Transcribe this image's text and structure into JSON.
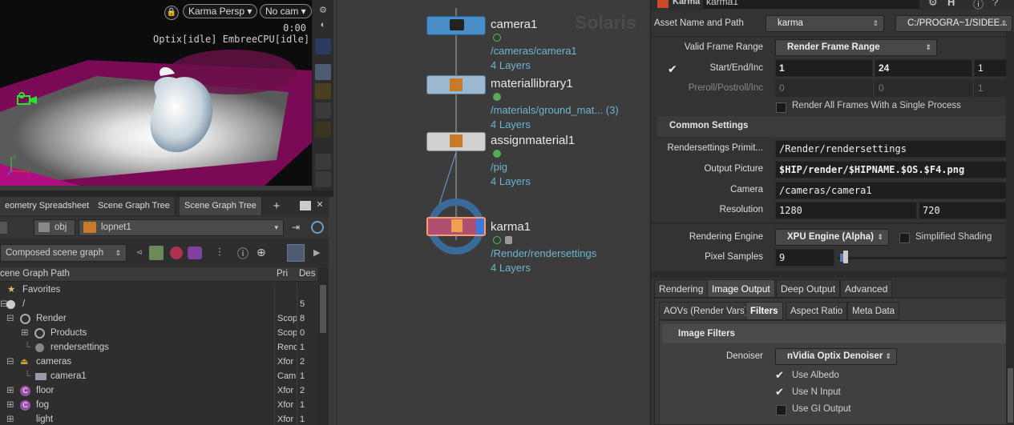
{
  "viewport": {
    "camera_menu": "Karma Persp",
    "view_menu": "No cam",
    "time": "0:00",
    "status": "Optix[idle] EmbreeCPU[idle]"
  },
  "scene_graph": {
    "tabs": [
      "eometry Spreadsheet",
      "Scene Graph Tree",
      "Scene Graph Tree"
    ],
    "path": {
      "obj": "obj",
      "lopnet": "lopnet1"
    },
    "mode": "Composed scene graph",
    "columns": {
      "path": "cene Graph Path",
      "pri": "Pri",
      "des": "Des"
    },
    "rows": [
      {
        "name": "Favorites",
        "pri": "",
        "des": ""
      },
      {
        "name": "/",
        "pri": "",
        "des": "5"
      },
      {
        "name": "Render",
        "pri": "Scop",
        "des": "8"
      },
      {
        "name": "Products",
        "pri": "Scop",
        "des": "0"
      },
      {
        "name": "rendersettings",
        "pri": "Rend",
        "des": "1"
      },
      {
        "name": "cameras",
        "pri": "Xfor",
        "des": "2"
      },
      {
        "name": "camera1",
        "pri": "Cam",
        "des": "1"
      },
      {
        "name": "floor",
        "pri": "Xfor",
        "des": "2"
      },
      {
        "name": "fog",
        "pri": "Xfor",
        "des": "1"
      },
      {
        "name": "light",
        "pri": "Xfor",
        "des": "1"
      }
    ]
  },
  "network": {
    "watermark": "Solaris",
    "nodes": [
      {
        "name": "camera1",
        "path": "/cameras/camera1",
        "layers": "4 Layers"
      },
      {
        "name": "materiallibrary1",
        "path": "/materials/ground_mat... (3)",
        "layers": "4 Layers"
      },
      {
        "name": "assignmaterial1",
        "path": "/pig",
        "layers": "4 Layers"
      },
      {
        "name": "karma1",
        "path": "/Render/rendersettings",
        "layers": "4 Layers"
      }
    ]
  },
  "params": {
    "node_type": "Karma",
    "node_name": "karma1",
    "asset_label": "Asset Name and Path",
    "asset_name": "karma",
    "asset_path": "C:/PROGRA~1/SIDEE...",
    "valid_frame_range_label": "Valid Frame Range",
    "valid_frame_range": "Render Frame Range",
    "start_end_inc_label": "Start/End/Inc",
    "start": "1",
    "end": "24",
    "inc": "1",
    "preroll_label": "Preroll/Postroll/Inc",
    "preroll": "0",
    "postroll": "0",
    "preroll_inc": "1",
    "render_all_frames": "Render All Frames With a Single Process",
    "common_settings": "Common Settings",
    "rendersettings_label": "Rendersettings Primit...",
    "rendersettings": "/Render/rendersettings",
    "output_label": "Output Picture",
    "output": "$HIP/render/$HIPNAME.$OS.$F4.png",
    "camera_label": "Camera",
    "camera": "/cameras/camera1",
    "resolution_label": "Resolution",
    "res_x": "1280",
    "res_y": "720",
    "engine_label": "Rendering Engine",
    "engine": "XPU Engine (Alpha)",
    "simplified_shading": "Simplified Shading",
    "pixel_samples_label": "Pixel Samples",
    "pixel_samples": "9",
    "main_tabs": [
      "Rendering",
      "Image Output",
      "Deep Output",
      "Advanced"
    ],
    "sub_tabs": [
      "AOVs (Render Vars)",
      "Filters",
      "Aspect Ratio",
      "Meta Data"
    ],
    "image_filters": "Image Filters",
    "denoiser_label": "Denoiser",
    "denoiser": "nVidia Optix Denoiser",
    "use_albedo": "Use Albedo",
    "use_n_input": "Use N Input",
    "use_gi_output": "Use GI Output"
  }
}
